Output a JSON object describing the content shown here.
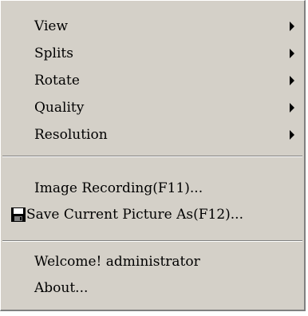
{
  "context_menu": {
    "group1": [
      {
        "label": "View",
        "submenu": true
      },
      {
        "label": "Splits",
        "submenu": true
      },
      {
        "label": "Rotate",
        "submenu": true
      },
      {
        "label": "Quality",
        "submenu": true
      },
      {
        "label": "Resolution",
        "submenu": true
      }
    ],
    "group2": [
      {
        "label": "Image Recording(F11)..."
      },
      {
        "label": "Save Current Picture As(F12)...",
        "icon": "floppy-disk-icon"
      }
    ],
    "group3": [
      {
        "label": "Welcome! administrator"
      },
      {
        "label": "About..."
      }
    ]
  }
}
